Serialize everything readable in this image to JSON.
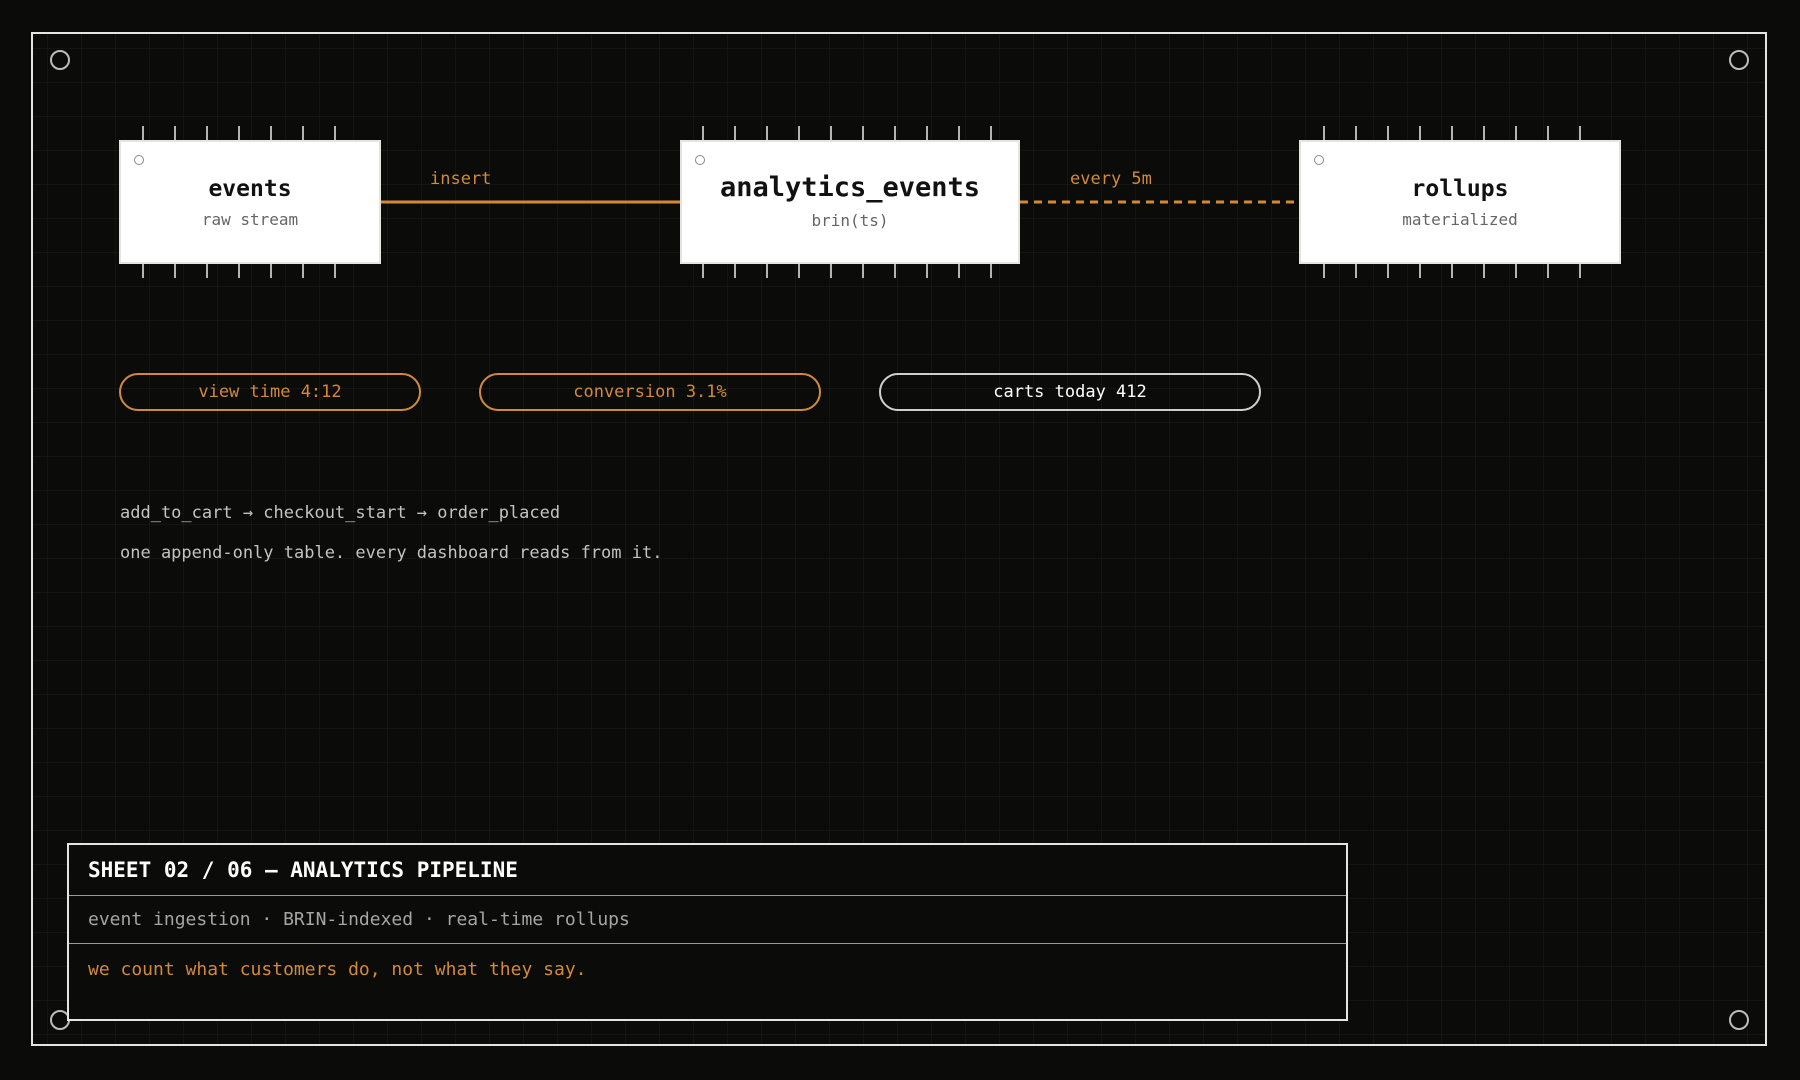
{
  "diagram": {
    "nodes": [
      {
        "id": "events",
        "title": "events",
        "subtitle": "raw stream"
      },
      {
        "id": "analytics_events",
        "title": "analytics_events",
        "subtitle": "brin(ts)"
      },
      {
        "id": "rollups",
        "title": "rollups",
        "subtitle": "materialized"
      }
    ],
    "edges": [
      {
        "from": "events",
        "to": "analytics_events",
        "label": "insert",
        "style": "solid"
      },
      {
        "from": "analytics_events",
        "to": "rollups",
        "label": "every 5m",
        "style": "dashed"
      }
    ]
  },
  "metrics": [
    {
      "label": "view time 4:12",
      "accent": "orange"
    },
    {
      "label": "conversion 3.1%",
      "accent": "orange"
    },
    {
      "label": "carts today 412",
      "accent": "white"
    }
  ],
  "notes": {
    "flow": "add_to_cart → checkout_start → order_placed",
    "caption": "one append-only table. every dashboard reads from it."
  },
  "title_block": {
    "title": "SHEET 02 / 06 — ANALYTICS PIPELINE",
    "subtitle": "event ingestion · BRIN-indexed · real-time rollups",
    "quote": "we count what customers do, not what they say."
  },
  "colors": {
    "background": "#0b0b0a",
    "accent": "#d28a3a",
    "node_fill": "#ffffff",
    "line": "#e4e4e0"
  }
}
